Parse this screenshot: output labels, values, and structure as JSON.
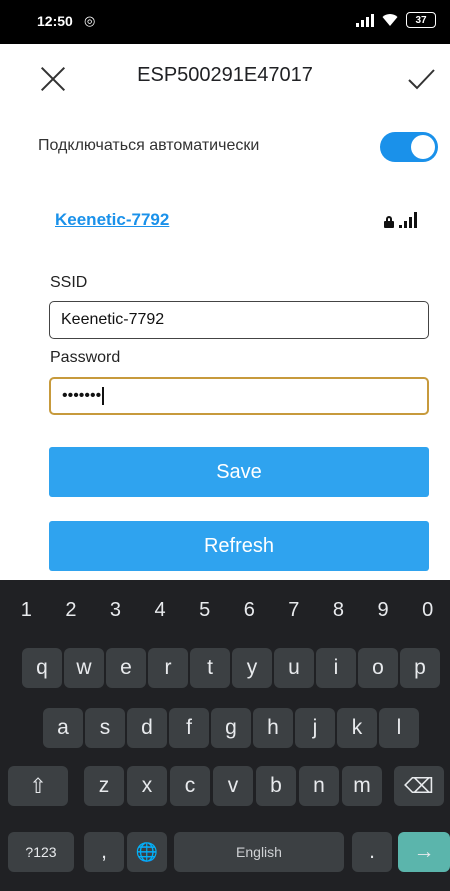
{
  "status_bar": {
    "time": "12:50",
    "battery": "37"
  },
  "app_bar": {
    "title": "ESP500291E47017"
  },
  "auto_connect": {
    "label": "Подключаться автоматически",
    "enabled": true
  },
  "network": {
    "name": "Keenetic-7792"
  },
  "form": {
    "ssid_label": "SSID",
    "ssid_value": "Keenetic-7792",
    "password_label": "Password",
    "password_masked": "•••••••"
  },
  "buttons": {
    "save": "Save",
    "refresh": "Refresh"
  },
  "keyboard": {
    "numbers": [
      "1",
      "2",
      "3",
      "4",
      "5",
      "6",
      "7",
      "8",
      "9",
      "0"
    ],
    "row1": [
      "q",
      "w",
      "e",
      "r",
      "t",
      "y",
      "u",
      "i",
      "o",
      "p"
    ],
    "row2": [
      "a",
      "s",
      "d",
      "f",
      "g",
      "h",
      "j",
      "k",
      "l"
    ],
    "row3": [
      "z",
      "x",
      "c",
      "v",
      "b",
      "n",
      "m"
    ],
    "symbols_key": "?123",
    "comma_key": ",",
    "space_label": "English",
    "period_key": ".",
    "shift_symbol": "⇧",
    "backspace_symbol": "⌫",
    "enter_symbol": "→",
    "globe_symbol": "🌐"
  },
  "colors": {
    "accent": "#1a91ea",
    "button": "#2fa3ef",
    "keyboard_bg": "#202124",
    "key_bg": "#3c4043",
    "enter_key": "#5bb5ac",
    "focus_border": "#c79a3c"
  }
}
